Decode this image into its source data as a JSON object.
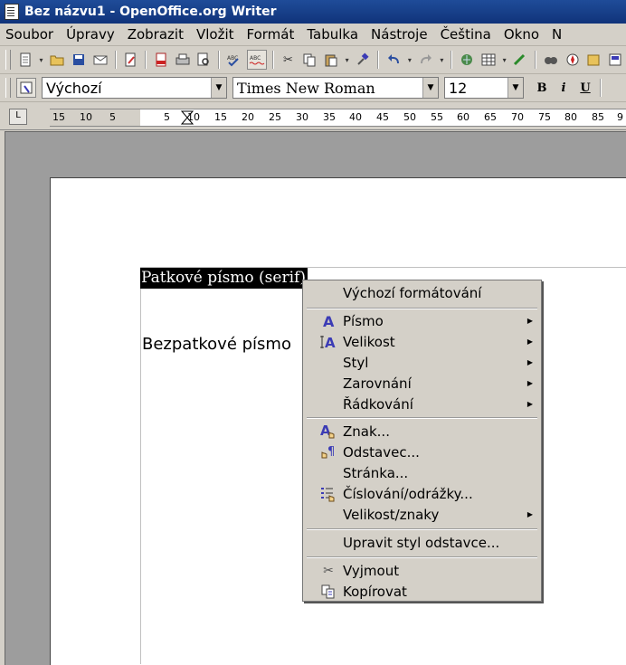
{
  "window": {
    "title": "Bez názvu1 - OpenOffice.org Writer"
  },
  "menubar": [
    "Soubor",
    "Úpravy",
    "Zobrazit",
    "Vložit",
    "Formát",
    "Tabulka",
    "Nástroje",
    "Čeština",
    "Okno",
    "N"
  ],
  "format_toolbar": {
    "paragraph_style": "Výchozí",
    "font_name": "Times New Roman",
    "font_size": "12",
    "bold_label": "B",
    "italic_label": "i",
    "underline_label": "U"
  },
  "ruler": {
    "corner_label": "L",
    "ticks": [
      "15",
      "10",
      "5",
      "5",
      "10",
      "15",
      "20",
      "25",
      "30",
      "35",
      "40",
      "45",
      "50",
      "55",
      "60",
      "65",
      "70",
      "75",
      "80",
      "85",
      "9"
    ]
  },
  "document": {
    "line1": "Patkové písmo (serif)",
    "line2": "Bezpatkové písmo"
  },
  "context_menu": {
    "items": [
      {
        "label": "Výchozí formátování",
        "icon": "",
        "submenu": false
      },
      {
        "label": "Písmo",
        "icon": "font-icon",
        "submenu": true
      },
      {
        "label": "Velikost",
        "icon": "font-size-icon",
        "submenu": true
      },
      {
        "label": "Styl",
        "icon": "",
        "submenu": true
      },
      {
        "label": "Zarovnání",
        "icon": "",
        "submenu": true
      },
      {
        "label": "Řádkování",
        "icon": "",
        "submenu": true
      },
      {
        "label": "Znak...",
        "icon": "character-icon",
        "submenu": false
      },
      {
        "label": "Odstavec...",
        "icon": "paragraph-icon",
        "submenu": false
      },
      {
        "label": "Stránka...",
        "icon": "",
        "submenu": false
      },
      {
        "label": "Číslování/odrážky...",
        "icon": "numbering-icon",
        "submenu": false
      },
      {
        "label": "Velikost/znaky",
        "icon": "",
        "submenu": true
      },
      {
        "label": "Upravit styl odstavce...",
        "icon": "",
        "submenu": false
      },
      {
        "label": "Vyjmout",
        "icon": "cut-icon",
        "submenu": false
      },
      {
        "label": "Kopírovat",
        "icon": "copy-icon",
        "submenu": false
      }
    ]
  },
  "colors": {
    "titlebar": "#1f4c99",
    "menu_bg": "#d4d0c8",
    "icon_accent": "#3b3bb5"
  }
}
